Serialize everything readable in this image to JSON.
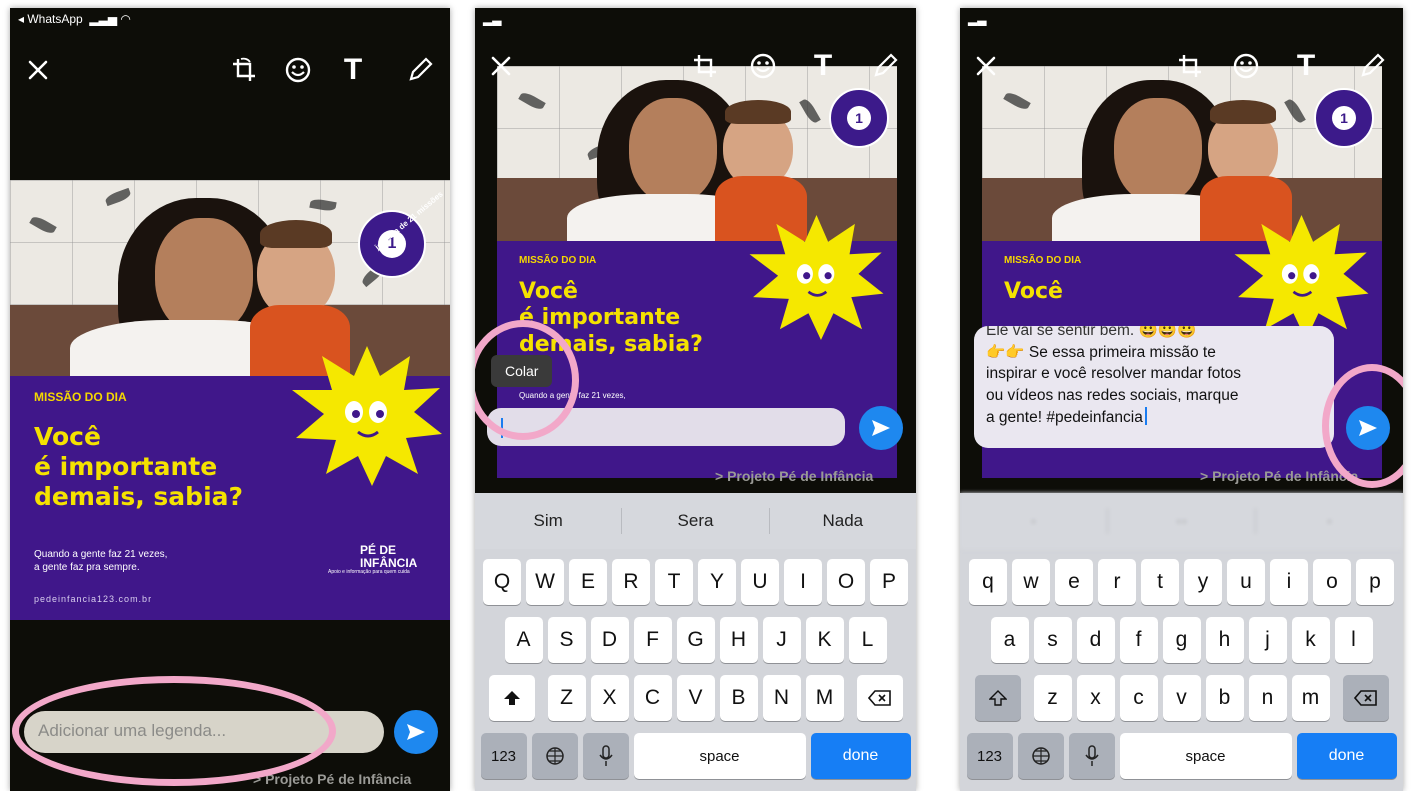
{
  "screens": [
    {
      "status": "◂ WhatsApp",
      "toolbar": {
        "close": "close",
        "crop": "crop-rotate",
        "emoji": "emoji",
        "text_tool": "T",
        "draw": "pencil"
      },
      "card": {
        "badge_text": "jornada de 21 missões",
        "badge_num": "1",
        "missao": "MISSÃO DO DIA",
        "line1": "Você",
        "line2": "é importante",
        "line3": "demais, sabia?",
        "sub1": "Quando a gente faz 21 vezes,",
        "sub2": "a gente faz pra sempre.",
        "url": "pedeinfancia123.com.br",
        "logo1": "PÉ DE",
        "logo2": "INFÂNCIA",
        "tagline": "Apoio e informação para quem cuida"
      },
      "caption_placeholder": "Adicionar uma legenda...",
      "footer": "> Projeto Pé de Infância"
    },
    {
      "card": {
        "missao": "MISSÃO DO DIA",
        "line1": "Você",
        "line2": "é importante",
        "line3": "demais, sabia?",
        "sub1": "Quando a gente faz 21 vezes,"
      },
      "paste_label": "Colar",
      "footer": "> Projeto Pé de Infância",
      "suggestions": [
        "Sim",
        "Sera",
        "Nada"
      ],
      "keys_row1": [
        "Q",
        "W",
        "E",
        "R",
        "T",
        "Y",
        "U",
        "I",
        "O",
        "P"
      ],
      "keys_row2": [
        "A",
        "S",
        "D",
        "F",
        "G",
        "H",
        "J",
        "K",
        "L"
      ],
      "keys_row3": [
        "Z",
        "X",
        "C",
        "V",
        "B",
        "N",
        "M"
      ],
      "key_123": "123",
      "key_space": "space",
      "key_done": "done"
    },
    {
      "card": {
        "missao": "MISSÃO DO DIA",
        "line1": "Você"
      },
      "caption_partial": "Ele vai se sentir bem. 😀😀😀",
      "caption_line1": "👉👉 Se essa primeira missão te",
      "caption_line2": "inspirar e você resolver mandar fotos",
      "caption_line3": "ou vídeos nas redes sociais, marque",
      "caption_line4": "a gente!  #pedeinfancia",
      "footer": "> Projeto Pé de Infância",
      "keys_row1": [
        "q",
        "w",
        "e",
        "r",
        "t",
        "y",
        "u",
        "i",
        "o",
        "p"
      ],
      "keys_row2": [
        "a",
        "s",
        "d",
        "f",
        "g",
        "h",
        "j",
        "k",
        "l"
      ],
      "keys_row3": [
        "z",
        "x",
        "c",
        "v",
        "b",
        "n",
        "m"
      ],
      "key_123": "123",
      "key_space": "space",
      "key_done": "done"
    }
  ],
  "colors": {
    "highlight_ring": "#f2a8c9",
    "send_blue": "#1e88ef",
    "card_purple": "#40178a",
    "headline_yellow": "#f5e200"
  }
}
